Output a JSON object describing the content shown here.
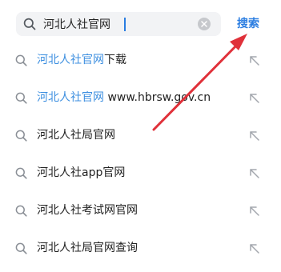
{
  "search": {
    "query": "河北人社官网",
    "submit_label": "搜索",
    "icon": "search-icon",
    "clear_icon": "clear-icon"
  },
  "suggestions": [
    {
      "highlight": "河北人社官网",
      "rest": "下载"
    },
    {
      "highlight": "河北人社官网",
      "rest": " www.hbrsw.gov.cn"
    },
    {
      "highlight": "",
      "rest": "河北人社局官网"
    },
    {
      "highlight": "",
      "rest": "河北人社app官网"
    },
    {
      "highlight": "",
      "rest": "河北人社考试网官网"
    },
    {
      "highlight": "",
      "rest": "河北人社局官网查询"
    }
  ],
  "colors": {
    "accent": "#2a7de1",
    "highlight": "#3d8fe0",
    "annotation_arrow": "#e0313a",
    "search_bg": "#f2f3f5"
  },
  "icons": {
    "suggestion_leading": "search-icon",
    "suggestion_trailing": "arrow-up-left-icon"
  }
}
